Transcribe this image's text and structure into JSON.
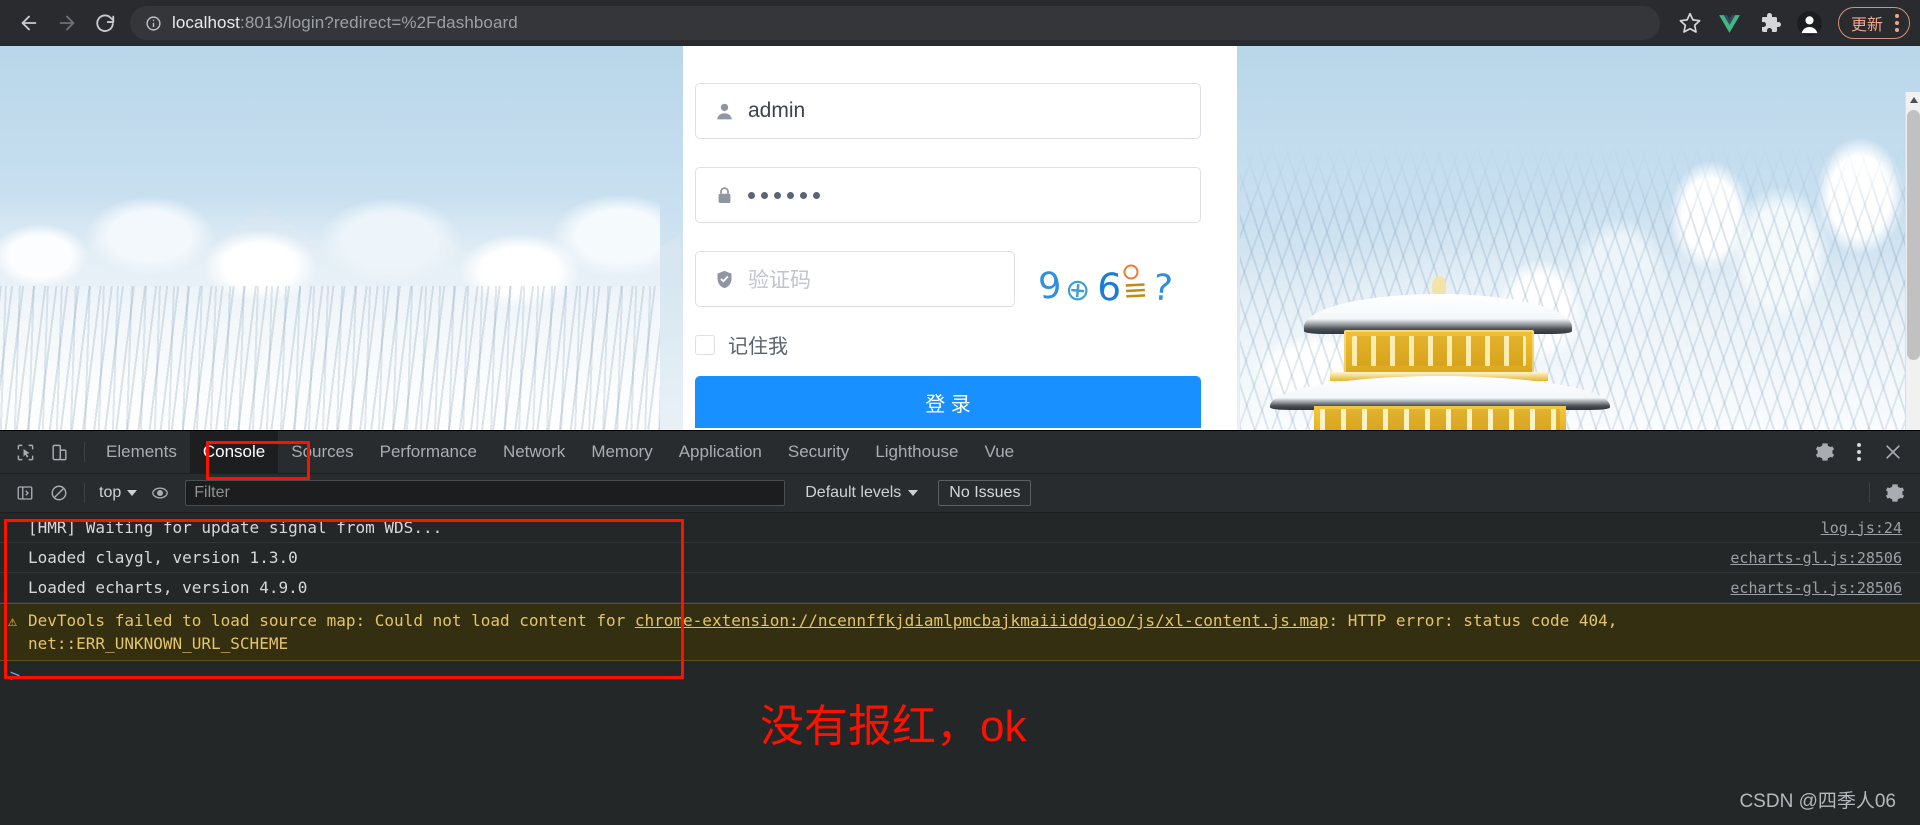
{
  "browser": {
    "back_label": "back-arrow",
    "forward_label": "forward-arrow",
    "reload_label": "reload",
    "site_info_label": "site-info",
    "url_host": "localhost",
    "url_rest": ":8013/login?redirect=%2Fdashboard",
    "bookmark_label": "star",
    "vue_devtools_label": "Vue",
    "extensions_label": "extensions",
    "profile_label": "profile",
    "update_label": "更新",
    "menu_label": "chrome-menu"
  },
  "login": {
    "username_value": "admin",
    "username_placeholder": "",
    "password_value": "••••••",
    "captcha_placeholder": "验证码",
    "captcha_image_chars": "9 ⊕ 6 ≡ ?",
    "remember_label": "记住我",
    "submit_label": "登 录"
  },
  "devtools": {
    "tabs": [
      {
        "label": "Elements",
        "active": false
      },
      {
        "label": "Console",
        "active": true
      },
      {
        "label": "Sources",
        "active": false
      },
      {
        "label": "Performance",
        "active": false
      },
      {
        "label": "Network",
        "active": false
      },
      {
        "label": "Memory",
        "active": false
      },
      {
        "label": "Application",
        "active": false
      },
      {
        "label": "Security",
        "active": false
      },
      {
        "label": "Lighthouse",
        "active": false
      },
      {
        "label": "Vue",
        "active": false
      }
    ],
    "inspect_label": "inspect-element",
    "device_label": "toggle-device-toolbar",
    "settings_label": "settings",
    "more_label": "more-options",
    "close_label": "close-devtools",
    "filterbar": {
      "sidebar_toggle_label": "console-sidebar",
      "clear_label": "clear-console",
      "context": "top",
      "live_expression_label": "create-live-expression",
      "filter_placeholder": "Filter",
      "levels": "Default levels",
      "issues": "No Issues",
      "settings_label": "console-settings"
    },
    "logs": [
      {
        "text": "[HMR] Waiting for update signal from WDS...",
        "source": "log.js:24",
        "level": "info"
      },
      {
        "text": "Loaded claygl, version 1.3.0",
        "source": "echarts-gl.js:28506",
        "level": "info"
      },
      {
        "text": "Loaded echarts, version 4.9.0",
        "source": "echarts-gl.js:28506",
        "level": "info"
      }
    ],
    "warning": {
      "prefix": "DevTools failed to load source map: Could not load content for ",
      "link": "chrome-extension://ncennffkjdiamlpmcbajkmaiiiddgioo/js/xl-content.js.map",
      "suffix": ": HTTP error: status code 404,",
      "line2": "net::ERR_UNKNOWN_URL_SCHEME"
    },
    "prompt_caret": ">"
  },
  "annotations": {
    "note_text": "没有报红，ok",
    "note_color": "#ff1100",
    "box_color": "#ff1100"
  },
  "watermark": "CSDN @四季人06"
}
